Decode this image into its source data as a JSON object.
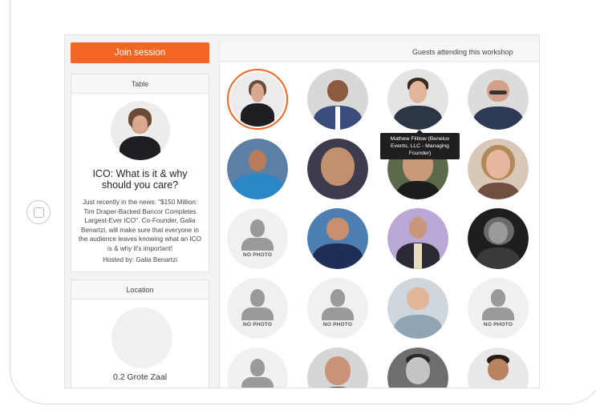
{
  "session": {
    "join_label": "Join session"
  },
  "table": {
    "header": "Table",
    "title": "ICO: What is it & why should you care?",
    "description": "Just recently in the news: \"$150 Million: Tim Draper-Backed Bancor Completes Largest-Ever ICO\". Co-Founder, Galia Benartzi, will make sure that everyone in the audience leaves knowing what an ICO is & why it's important!",
    "hosted_by": "Hosted by: Galia Benartzi"
  },
  "location": {
    "header": "Location",
    "name": "0.2 Grote Zaal"
  },
  "guests": {
    "header": "Guests attending this workshop",
    "no_photo_label": "NO PHOTO",
    "tooltip": "Mathew Flitlow (Benelux Events, LLC - Managing Founder)",
    "colors": {
      "accent": "#f26522",
      "no_photo_bg": "#f0f0f0"
    }
  }
}
